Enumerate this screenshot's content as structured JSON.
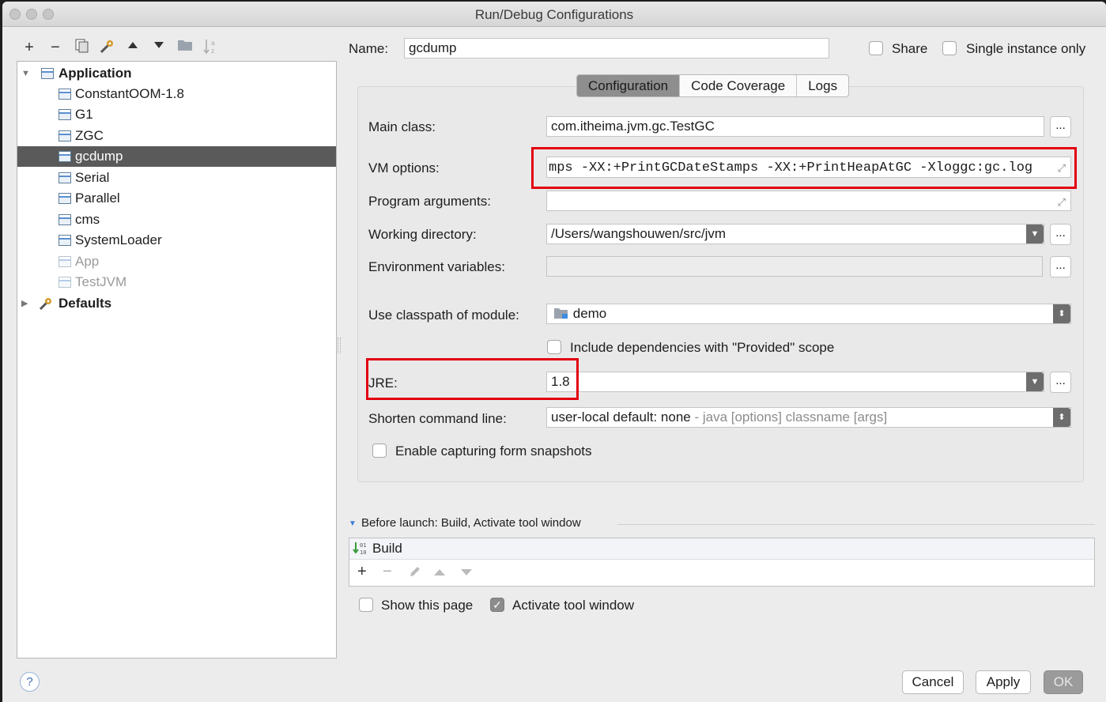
{
  "window": {
    "title": "Run/Debug Configurations"
  },
  "toolbar": {
    "add": "+",
    "remove": "−"
  },
  "tree": {
    "application": "Application",
    "items": [
      {
        "label": "ConstantOOM-1.8"
      },
      {
        "label": "G1"
      },
      {
        "label": "ZGC"
      },
      {
        "label": "gcdump"
      },
      {
        "label": "Serial"
      },
      {
        "label": "Parallel"
      },
      {
        "label": "cms"
      },
      {
        "label": "SystemLoader"
      },
      {
        "label": "App"
      },
      {
        "label": "TestJVM"
      }
    ],
    "defaults": "Defaults"
  },
  "header": {
    "name_label": "Name:",
    "name_value": "gcdump",
    "share_label": "Share",
    "single_instance_label": "Single instance only"
  },
  "tabs": [
    "Configuration",
    "Code Coverage",
    "Logs"
  ],
  "form": {
    "main_class_label": "Main class:",
    "main_class_value": "com.itheima.jvm.gc.TestGC",
    "vm_options_label": "VM options:",
    "vm_options_value": "mps -XX:+PrintGCDateStamps -XX:+PrintHeapAtGC -Xloggc:gc.log",
    "program_args_label": "Program arguments:",
    "working_dir_label": "Working directory:",
    "working_dir_value": "/Users/wangshouwen/src/jvm",
    "env_vars_label": "Environment variables:",
    "classpath_label": "Use classpath of module:",
    "classpath_value": "demo",
    "include_deps_label": "Include dependencies with \"Provided\" scope",
    "jre_label": "JRE:",
    "jre_value": "1.8",
    "shorten_label": "Shorten command line:",
    "shorten_value": "user-local default: none",
    "shorten_hint": " - java [options] classname [args]",
    "snapshots_label": "Enable capturing form snapshots",
    "browse": "..."
  },
  "before_launch": {
    "title": "Before launch: Build, Activate tool window",
    "task": "Build"
  },
  "footer": {
    "show_page_label": "Show this page",
    "activate_tool_label": "Activate tool window",
    "help": "?",
    "cancel": "Cancel",
    "apply": "Apply",
    "ok": "OK"
  }
}
